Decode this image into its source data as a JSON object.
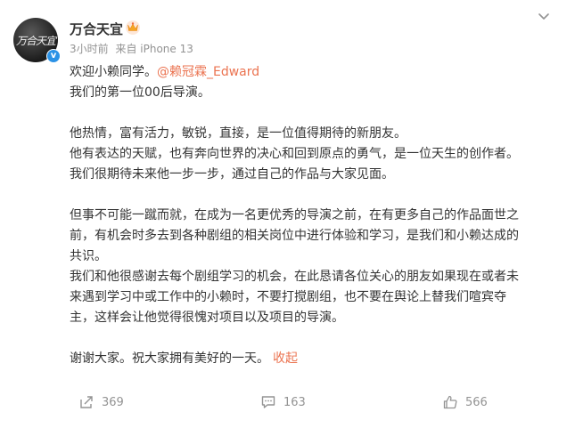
{
  "post": {
    "username": "万合天宜",
    "avatar_text": "万合天宜",
    "time": "3小时前",
    "source": "来自 iPhone 13",
    "paragraphs": [
      {
        "prefix": "欢迎小赖同学。",
        "mention": "@赖冠霖_Edward"
      },
      {
        "text": "我们的第一位00后导演。"
      },
      {
        "text": ""
      },
      {
        "text": "他热情，富有活力，敏锐，直接，是一位值得期待的新朋友。"
      },
      {
        "text": "他有表达的天赋，也有奔向世界的决心和回到原点的勇气，是一位天生的创作者。"
      },
      {
        "text": "我们很期待未来他一步一步，通过自己的作品与大家见面。"
      },
      {
        "text": ""
      },
      {
        "text": "但事不可能一蹴而就，在成为一名更优秀的导演之前，在有更多自己的作品面世之"
      },
      {
        "text": "前，有机会时多去到各种剧组的相关岗位中进行体验和学习，是我们和小赖达成的"
      },
      {
        "text": "共识。"
      },
      {
        "text": "我们和他很感谢去每个剧组学习的机会，在此恳请各位关心的朋友如果现在或者未"
      },
      {
        "text": "来遇到学习中或工作中的小赖时，不要打搅剧组，也不要在舆论上替我们喧宾夺"
      },
      {
        "text": "主，这样会让他觉得很愧对项目以及项目的导演。"
      },
      {
        "text": ""
      },
      {
        "prefix": "谢谢大家。祝大家拥有美好的一天。",
        "collapse": "收起"
      }
    ]
  },
  "actions": {
    "repost_count": "369",
    "comment_count": "163",
    "like_count": "566"
  },
  "colors": {
    "link": "#eb7350",
    "meta": "#939393",
    "verify": "#2b92e6"
  },
  "icons": [
    "crown-icon",
    "more-icon",
    "verified-icon",
    "repost-icon",
    "comment-icon",
    "like-icon"
  ]
}
